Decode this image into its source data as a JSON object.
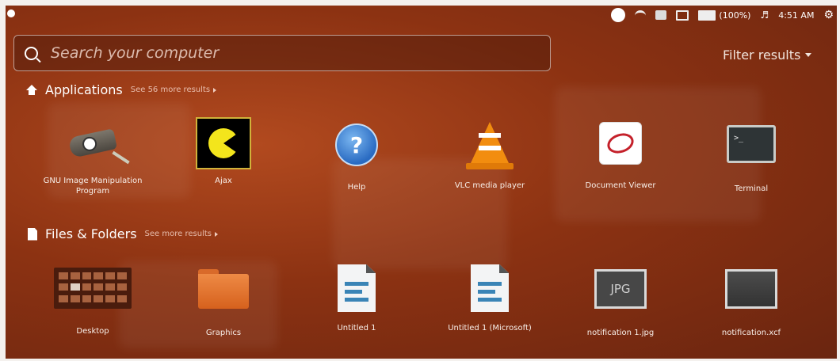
{
  "top_panel": {
    "battery_label": "(100%)",
    "clock": "4:51 AM"
  },
  "search": {
    "placeholder": "Search your computer",
    "filter_label": "Filter results"
  },
  "applications": {
    "title": "Applications",
    "more_label": "See 56 more results",
    "items": [
      {
        "label": "GNU Image Manipulation Program",
        "icon": "gimp-icon"
      },
      {
        "label": "Ajax",
        "icon": "pacman-icon"
      },
      {
        "label": "Help",
        "icon": "help-icon"
      },
      {
        "label": "VLC media player",
        "icon": "vlc-icon"
      },
      {
        "label": "Document Viewer",
        "icon": "document-viewer-icon"
      },
      {
        "label": "Terminal",
        "icon": "terminal-icon"
      }
    ]
  },
  "files": {
    "title": "Files & Folders",
    "more_label": "See more results",
    "items": [
      {
        "label": "Desktop",
        "icon": "calendar-icon"
      },
      {
        "label": "Graphics",
        "icon": "folder-icon"
      },
      {
        "label": "Untitled 1",
        "icon": "document-icon"
      },
      {
        "label": "Untitled 1 (Microsoft)",
        "icon": "document-icon"
      },
      {
        "label": "notification 1.jpg",
        "icon": "image-icon"
      },
      {
        "label": "notification.xcf",
        "icon": "image-icon"
      }
    ]
  }
}
